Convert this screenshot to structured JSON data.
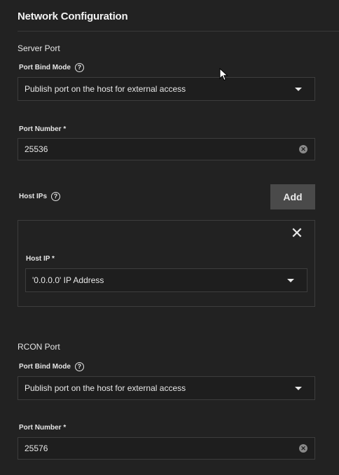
{
  "header": {
    "title": "Network Configuration"
  },
  "server_port": {
    "section_label": "Server Port",
    "bind_mode_label": "Port Bind Mode",
    "bind_mode_value": "Publish port on the host for external access",
    "port_number_label": "Port Number *",
    "port_number_value": "25536"
  },
  "host_ips": {
    "label": "Host IPs",
    "add_label": "Add",
    "item": {
      "host_ip_label": "Host IP *",
      "host_ip_value": "'0.0.0.0' IP Address"
    }
  },
  "rcon_port": {
    "section_label": "RCON Port",
    "bind_mode_label": "Port Bind Mode",
    "bind_mode_value": "Publish port on the host for external access",
    "port_number_label": "Port Number *",
    "port_number_value": "25576"
  },
  "icons": {
    "help": "help-circle-icon",
    "dropdown": "chevron-down-icon",
    "clear": "clear-circle-icon",
    "close": "close-icon",
    "cursor": "mouse-pointer-icon"
  },
  "colors": {
    "background": "#222222",
    "field_background": "#1e1e1e",
    "border": "#3d3d3d",
    "button": "#4a4a4a",
    "text": "#e8e8e8"
  }
}
